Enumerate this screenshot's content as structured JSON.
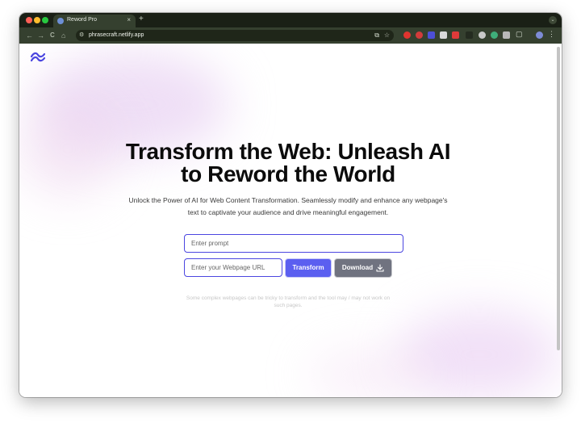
{
  "browser": {
    "tab": {
      "title": "Reword Pro",
      "close_glyph": "×",
      "favicon": "globe-icon"
    },
    "new_tab_glyph": "+",
    "tab_search_glyph": "⌄",
    "nav": {
      "back": "←",
      "forward": "→",
      "reload": "C",
      "home": "⌂"
    },
    "address": {
      "site_info_glyph": "⚙",
      "url": "phrasecraft.netlify.app",
      "cast_glyph": "⧉",
      "bookmark_glyph": "☆"
    },
    "extensions_glyph": "▢",
    "menu_glyph": "⋮"
  },
  "page": {
    "headline_line1": "Transform the Web: Unleash AI",
    "headline_line2": "to Reword the World",
    "subhead_line1": "Unlock the Power of AI for Web Content Transformation. Seamlessly modify and enhance any webpage's",
    "subhead_line2": "text to captivate your audience and drive meaningful engagement.",
    "prompt_placeholder": "Enter prompt",
    "url_placeholder": "Enter your Webpage URL",
    "transform_label": "Transform",
    "download_label": "Download",
    "footnote_line1": "Some complex webpages can be tricky to transform and the tool may / may not work on",
    "footnote_line2": "such pages."
  },
  "colors": {
    "accent": "#5b5ff0",
    "input_border": "#4b46e0",
    "download_bg": "#707380",
    "browser_chrome": "#35402f",
    "logo": "#4b46e0"
  }
}
